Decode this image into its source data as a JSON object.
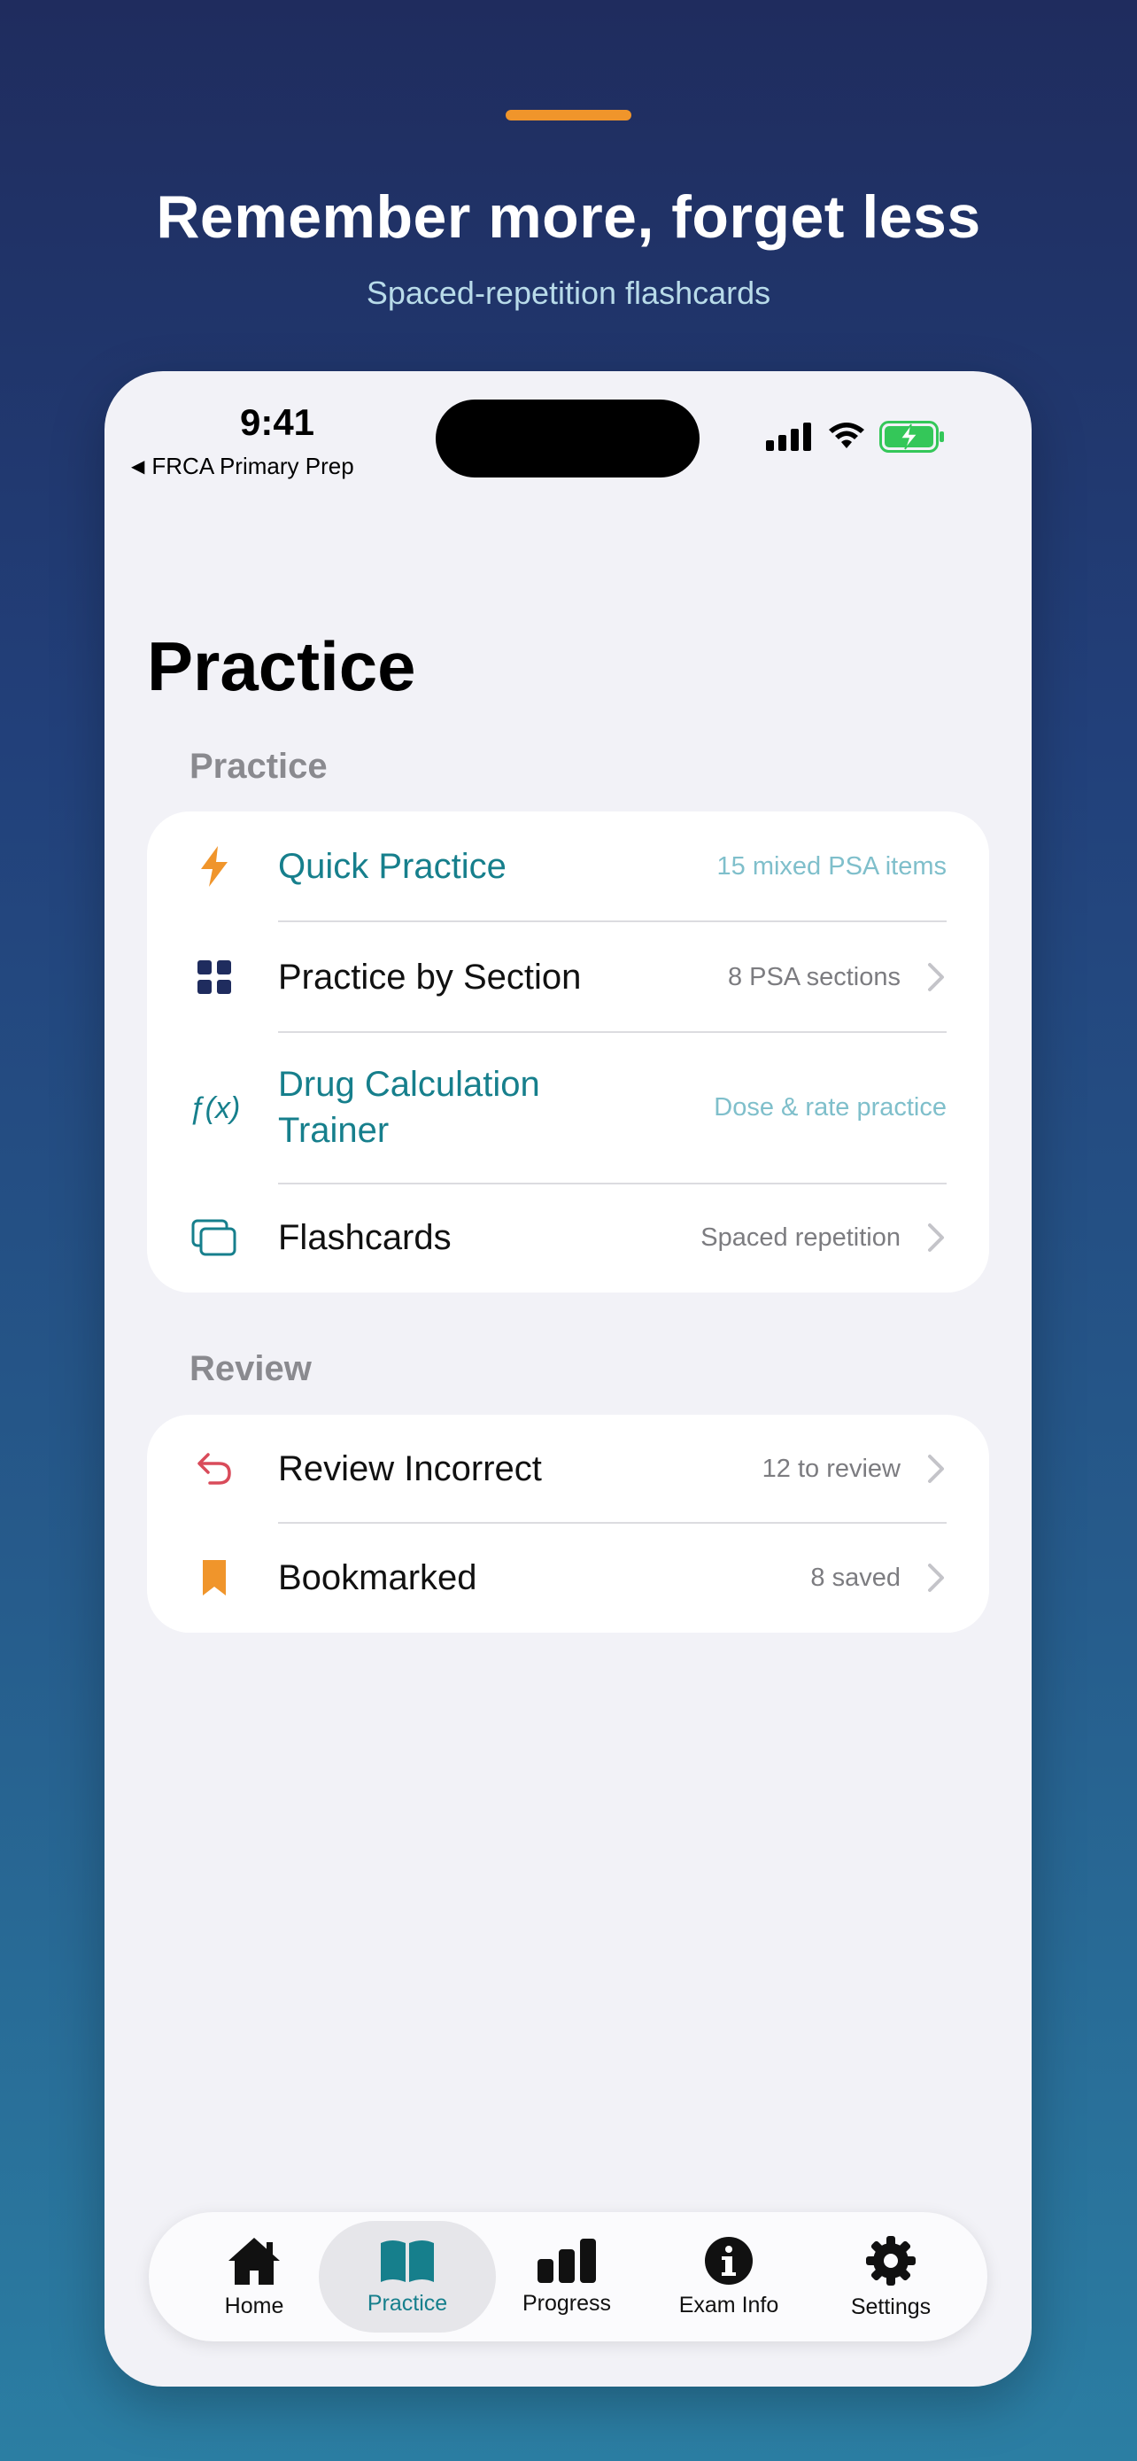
{
  "promo": {
    "headline": "Remember more, forget less",
    "subheadline": "Spaced-repetition flashcards",
    "accent_color": "#f0952b"
  },
  "status_bar": {
    "time": "9:41",
    "back_app": "FRCA Primary Prep",
    "icons": [
      "signal-icon",
      "wifi-icon",
      "battery-charging-icon"
    ]
  },
  "page": {
    "title": "Practice"
  },
  "sections": {
    "practice": {
      "header": "Practice",
      "rows": [
        {
          "label": "Quick Practice",
          "detail": "15 mixed PSA items",
          "icon": "bolt-icon",
          "highlight": true
        },
        {
          "label": "Practice by Section",
          "detail": "8 PSA sections",
          "icon": "grid-icon",
          "highlight": false
        },
        {
          "label_line1": "Drug Calculation",
          "label_line2": "Trainer",
          "detail": "Dose & rate practice",
          "icon": "function-icon",
          "highlight": true
        },
        {
          "label": "Flashcards",
          "detail": "Spaced repetition",
          "icon": "cards-icon",
          "highlight": false
        }
      ]
    },
    "review": {
      "header": "Review",
      "rows": [
        {
          "label": "Review Incorrect",
          "detail": "12 to review",
          "icon": "undo-arrow-icon"
        },
        {
          "label": "Bookmarked",
          "detail": "8 saved",
          "icon": "bookmark-icon"
        }
      ]
    }
  },
  "function_glyph": "ƒ(x)",
  "tabbar": {
    "items": [
      {
        "label": "Home",
        "icon": "house-icon"
      },
      {
        "label": "Practice",
        "icon": "book-icon",
        "active": true
      },
      {
        "label": "Progress",
        "icon": "bar-chart-icon"
      },
      {
        "label": "Exam Info",
        "icon": "info-icon"
      },
      {
        "label": "Settings",
        "icon": "gear-icon"
      }
    ]
  },
  "colors": {
    "teal": "#167f8c",
    "orange": "#f0952b",
    "navy": "#1f2c5e",
    "red": "#d94b5a"
  }
}
